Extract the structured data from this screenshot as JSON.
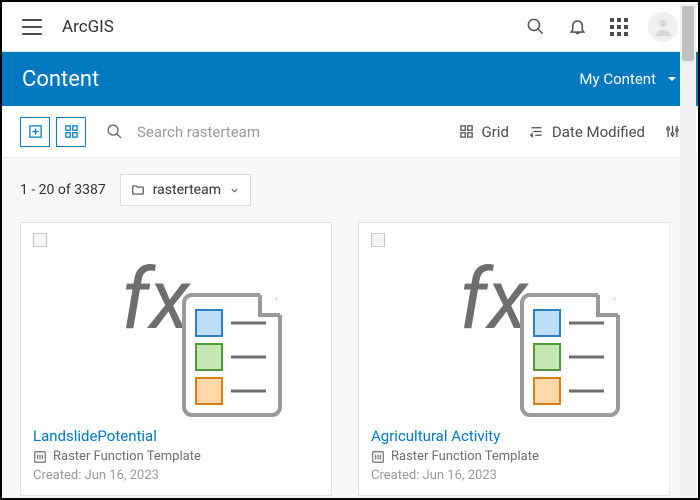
{
  "topbar": {
    "brand": "ArcGIS"
  },
  "banner": {
    "title": "Content",
    "dropdown": "My Content"
  },
  "toolbar": {
    "search_placeholder": "Search rasterteam",
    "view_label": "Grid",
    "sort_label": "Date Modified"
  },
  "content": {
    "count_text": "1 - 20 of 3387",
    "folder_name": "rasterteam"
  },
  "cards": [
    {
      "title": "LandslidePotential",
      "subtitle": "Raster Function Template",
      "date": "Created: Jun 16, 2023"
    },
    {
      "title": "Agricultural Activity",
      "subtitle": "Raster Function Template",
      "date": "Created: Jun 16, 2023"
    }
  ]
}
